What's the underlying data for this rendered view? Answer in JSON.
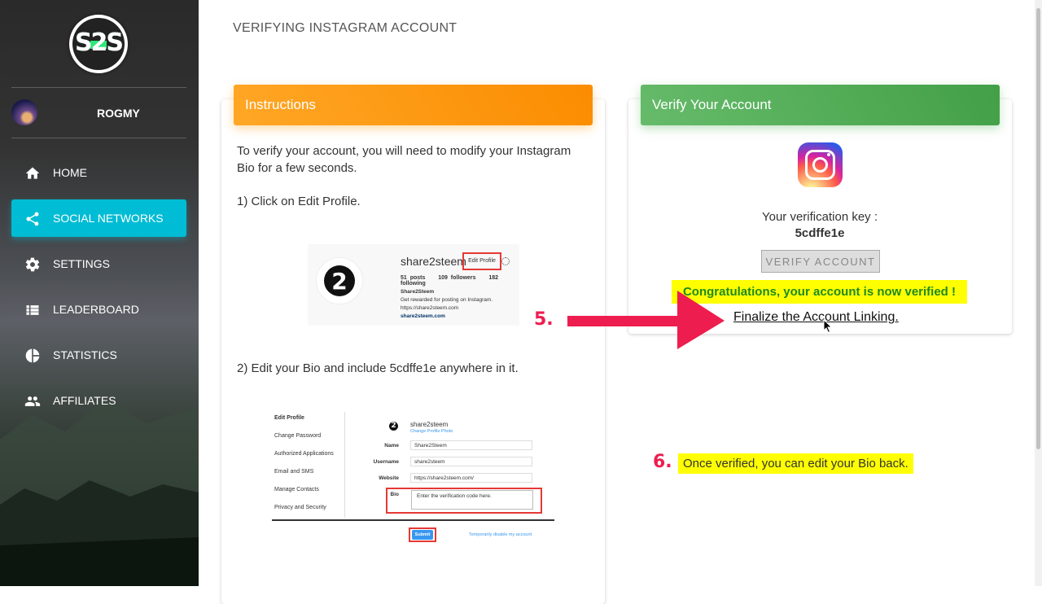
{
  "sidebar": {
    "logo_text": "S2S",
    "username": "ROGMY",
    "nav": [
      {
        "label": "HOME",
        "icon": "home-icon"
      },
      {
        "label": "SOCIAL NETWORKS",
        "icon": "share-icon",
        "active": true
      },
      {
        "label": "SETTINGS",
        "icon": "gear-icon"
      },
      {
        "label": "LEADERBOARD",
        "icon": "list-icon"
      },
      {
        "label": "STATISTICS",
        "icon": "pie-chart-icon"
      },
      {
        "label": "AFFILIATES",
        "icon": "people-icon"
      }
    ],
    "active_color": "#00bcd4"
  },
  "main": {
    "page_title": "VERIFYING INSTAGRAM ACCOUNT",
    "instructions": {
      "header": "Instructions",
      "intro": "To verify your account, you will need to modify your Instagram Bio for a few seconds.",
      "step1": "1) Click on Edit Profile.",
      "step2": "2) Edit your Bio and include 5cdffe1e anywhere in it.",
      "shot1": {
        "name": "share2steem",
        "edit_button": "Edit Profile",
        "posts": "51 posts",
        "followers": "109 followers",
        "following": "182 following",
        "bio_title": "Share2Steem",
        "bio_line": "Get rewarded for posting on Instagram.",
        "link1": "https://share2steem.com",
        "link2": "share2steem.com"
      },
      "shot2": {
        "menu": [
          "Edit Profile",
          "Change Password",
          "Authorized Applications",
          "Email and SMS",
          "Manage Contacts",
          "Privacy and Security"
        ],
        "account": "share2steem",
        "change_photo": "Change Profile Photo",
        "fields": [
          {
            "label": "Name",
            "value": "Share2Steem"
          },
          {
            "label": "Username",
            "value": "share2steem"
          },
          {
            "label": "Website",
            "value": "https://share2steem.com/"
          }
        ],
        "bio_label": "Bio",
        "bio_value": "Enter the verification code here.",
        "submit": "Submit",
        "disable_link": "Temporarily disable my account"
      }
    },
    "verify": {
      "header": "Verify Your Account",
      "key_label": "Your verification key :",
      "key": "5cdffe1e",
      "button": "VERIFY ACCOUNT",
      "success": "Congratulations, your account is now verified !",
      "finalize": "Finalize the Account Linking."
    },
    "annotations": {
      "step5": "5.",
      "step6": "6.",
      "note": "Once verified, you can edit your Bio back."
    }
  },
  "colors": {
    "orange": "#fb8c00",
    "green": "#43a047",
    "highlight": "#ffff00",
    "arrow": "#ee1d4f",
    "success_text": "#1d8a1d"
  }
}
